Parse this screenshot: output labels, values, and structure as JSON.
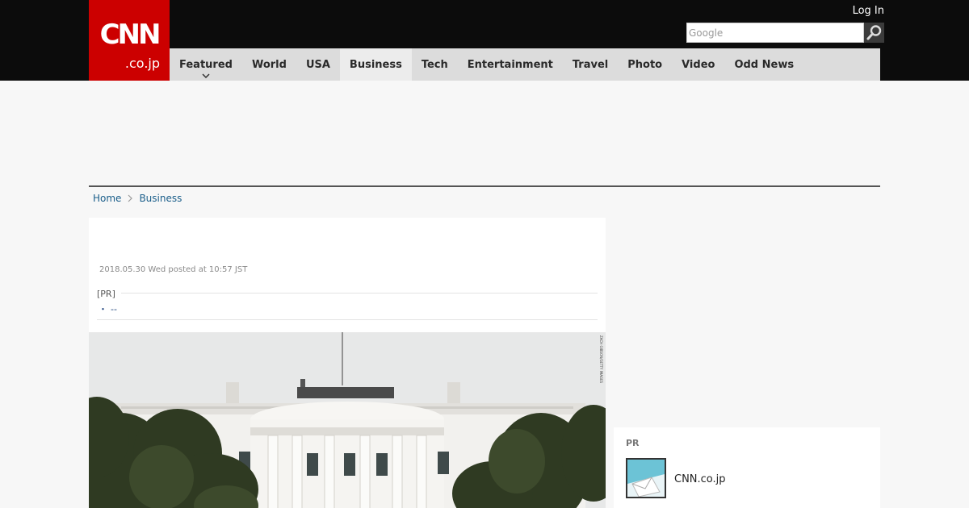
{
  "header": {
    "logo_main": "CNN",
    "logo_sub": ".co.jp",
    "login_label": "Log In",
    "search_placeholder": "Google",
    "search_icon": "search-icon",
    "brand_color": "#cc0000"
  },
  "nav": {
    "items": [
      {
        "label": "Featured"
      },
      {
        "label": "World"
      },
      {
        "label": "USA"
      },
      {
        "label": "Business"
      },
      {
        "label": "Tech"
      },
      {
        "label": "Entertainment"
      },
      {
        "label": "Travel"
      },
      {
        "label": "Photo"
      },
      {
        "label": "Video"
      },
      {
        "label": "Odd News"
      }
    ],
    "active": "Business"
  },
  "breadcrumb": {
    "items": [
      {
        "label": "Home"
      },
      {
        "label": "Business"
      }
    ]
  },
  "article": {
    "posted": "2018.05.30 Wed posted at 10:57 JST",
    "pr_label": "[PR]",
    "pr_bullet": "・",
    "pr_link": "--",
    "photo_credit": "ZACH GIBSON/GETTY IMAGES"
  },
  "sidebar": {
    "pr_title": "PR",
    "pr_item_name": "CNN.co.jp"
  }
}
